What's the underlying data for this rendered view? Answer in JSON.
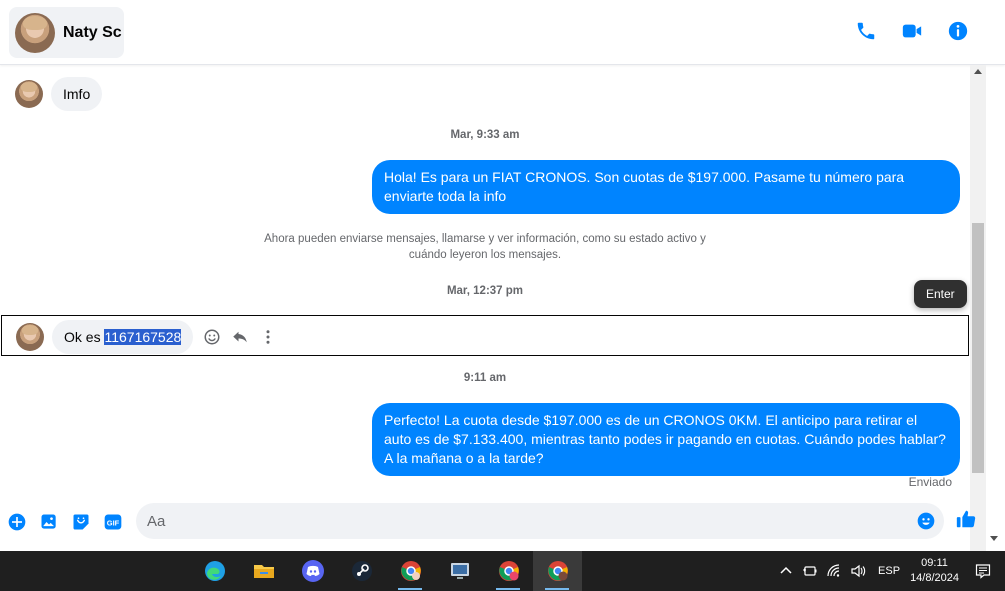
{
  "header": {
    "contact_name": "Naty Sc",
    "actions": [
      "phone-icon",
      "video-call-icon",
      "info-icon"
    ]
  },
  "conversation": {
    "messages": [
      {
        "type": "incoming",
        "text": "Imfo"
      },
      {
        "type": "timestamp",
        "text": "Mar, 9:33 am"
      },
      {
        "type": "outgoing",
        "text": "Hola! Es para un FIAT CRONOS. Son cuotas de $197.000. Pasame tu número para enviarte toda la info"
      },
      {
        "type": "system",
        "text": "Ahora pueden enviarse mensajes, llamarse y ver información, como su estado activo y cuándo leyeron los mensajes."
      },
      {
        "type": "timestamp",
        "text": "Mar, 12:37 pm"
      },
      {
        "type": "incoming",
        "text_prefix": "Ok es ",
        "text_highlight": "1167167528"
      },
      {
        "type": "timestamp",
        "text": "9:11 am"
      },
      {
        "type": "outgoing",
        "text": "Perfecto! La cuota desde $197.000 es de un CRONOS 0KM. El anticipo para retirar el auto es de $7.133.400, mientras tanto podes ir pagando en cuotas. Cuándo podes hablar? A la mañana o a la tarde?"
      }
    ],
    "status": "Enviado",
    "tooltip": "Enter"
  },
  "composer": {
    "placeholder": "Aa",
    "value": "",
    "gif_label": "GIF"
  },
  "taskbar": {
    "apps": [
      "edge-icon",
      "file-explorer-icon",
      "discord-icon",
      "steam-icon",
      "chrome-profile-icon",
      "app-window-icon",
      "chrome-c-icon",
      "chrome-c-icon"
    ],
    "language": "ESP",
    "time": "09:11",
    "date": "14/8/2024"
  },
  "colors": {
    "accent": "#0084ff",
    "incoming_bubble": "#f0f2f5",
    "highlight": "#2a5fcf",
    "taskbar": "#1f1f1f"
  }
}
